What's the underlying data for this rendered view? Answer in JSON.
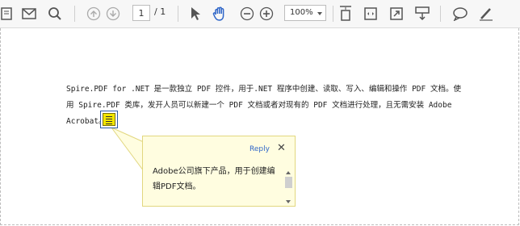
{
  "toolbar": {
    "page_current": "1",
    "page_total": "/ 1",
    "zoom_value": "100%"
  },
  "document": {
    "lines": [
      "Spire.PDF for .NET 是一款独立 PDF 控件，用于.NET 程序中创建、读取、写入、编辑和操作 PDF 文档。使",
      "用 Spire.PDF 类库，发开人员可以新建一个 PDF 文档或者对现有的 PDF 文档进行处理，且无需安装 Adobe",
      "Acrobat。"
    ]
  },
  "note": {
    "reply_label": "Reply",
    "close_label": "✕",
    "comment_lines": [
      "Adobe公司旗下产品，用于创建编",
      "辑PDF文档。"
    ]
  },
  "colors": {
    "accent": "#2f66c8",
    "note_fill": "#f2e600",
    "popup_bg": "#fffde0"
  }
}
